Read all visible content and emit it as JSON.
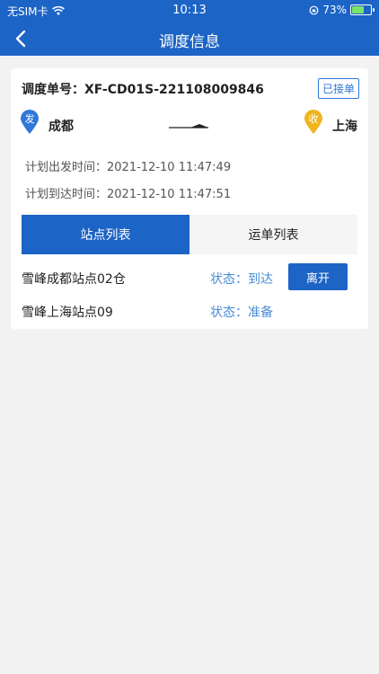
{
  "status_bar": {
    "carrier": "无SIM卡",
    "time": "10:13",
    "battery": "73%",
    "battery_fraction": 0.73
  },
  "nav": {
    "title": "调度信息"
  },
  "order": {
    "label": "调度单号：",
    "number": "XF-CD01S-221108009846",
    "status_badge": "已接单"
  },
  "route": {
    "from_marker": "发",
    "from_city": "成都",
    "to_marker": "收",
    "to_city": "上海"
  },
  "times": {
    "planned_departure_label": "计划出发时间：",
    "planned_departure_value": "2021-12-10 11:47:49",
    "planned_arrival_label": "计划到达时间：",
    "planned_arrival_value": "2021-12-10 11:47:51"
  },
  "tabs": [
    {
      "label": "站点列表",
      "active": true
    },
    {
      "label": "运单列表",
      "active": false
    }
  ],
  "stations": [
    {
      "name": "雪峰成都站点02仓",
      "status_label": "状态：",
      "status_value": "到达",
      "action": "离开"
    },
    {
      "name": "雪峰上海站点09",
      "status_label": "状态：",
      "status_value": "准备"
    }
  ],
  "colors": {
    "primary": "#1c64c6",
    "from_pin": "#2f78d8",
    "to_pin": "#f0b51e",
    "status_text": "#4a8bd6"
  }
}
